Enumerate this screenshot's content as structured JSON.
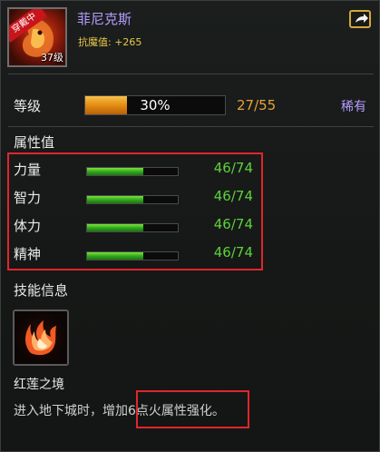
{
  "pet": {
    "name": "菲尼克斯",
    "equip_tag": "穿戴中",
    "level_tag": "37级",
    "resist_label": "抗魔值:",
    "resist_value": "+265"
  },
  "level": {
    "label": "等级",
    "progress": 0.3,
    "progress_text": "30%",
    "value_text": "27/55",
    "rarity": "稀有"
  },
  "attributes": {
    "title": "属性值",
    "items": [
      {
        "name": "力量",
        "value_text": "46/74",
        "fraction": 0.62
      },
      {
        "name": "智力",
        "value_text": "46/74",
        "fraction": 0.62
      },
      {
        "name": "体力",
        "value_text": "46/74",
        "fraction": 0.62
      },
      {
        "name": "精神",
        "value_text": "46/74",
        "fraction": 0.62
      }
    ]
  },
  "skill": {
    "section_title": "技能信息",
    "name": "红莲之境",
    "desc_prefix": "进入地下城时，增加",
    "desc_highlight": "6点火属性强化。"
  },
  "icons": {
    "portrait": "phoenix-portrait-icon",
    "share": "share-icon",
    "skill": "flame-bird-skill-icon"
  },
  "colors": {
    "name": "#b79cff",
    "resist": "#e8c94a",
    "exp_fill": "#e48b12",
    "attr_fill": "#2fa41c",
    "attr_value": "#5dd13a",
    "highlight_border": "#e0262b"
  }
}
